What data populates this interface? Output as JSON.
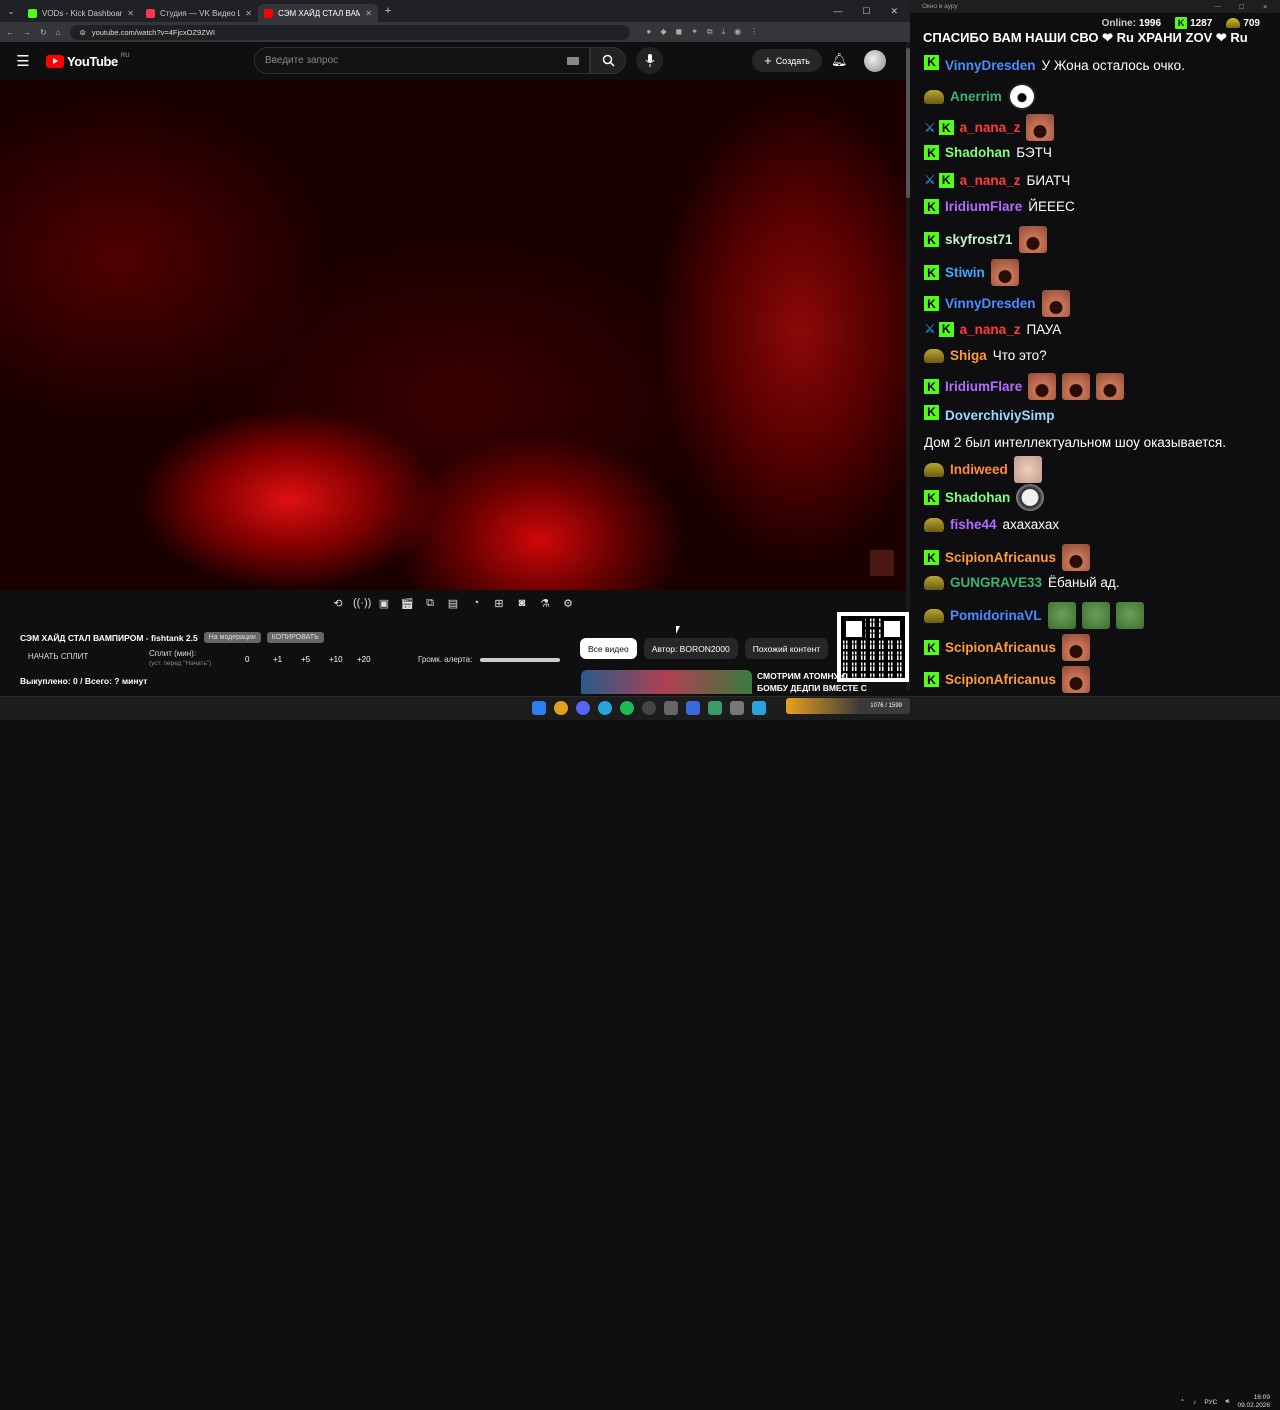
{
  "browser": {
    "tabs": [
      {
        "title": "VODs - Kick Dashboard",
        "favicon_color": "#53fc18"
      },
      {
        "title": "Студия — VK Видео Live",
        "favicon_color": "#ff3355"
      },
      {
        "title": "СЭМ ХАЙД СТАЛ ВАМПИ...",
        "favicon_color": "#ff0000",
        "active": true
      }
    ],
    "url": "youtube.com/watch?v=4FjcxOZ9ZWI",
    "window_controls": [
      "—",
      "☐",
      "✕"
    ]
  },
  "youtube": {
    "logo_text": "YouTube",
    "region": "RU",
    "search_placeholder": "Введите запрос",
    "create_label": "Создать"
  },
  "player_tools": [
    "loop",
    "audio",
    "screen-record",
    "clip",
    "pip",
    "subtitles",
    "speed",
    "add",
    "screenshot",
    "test",
    "settings"
  ],
  "panel": {
    "video_title": "СЭМ ХАЙД СТАЛ ВАМПИРОМ - fishtank 2.5",
    "pill_1": "На модерации",
    "pill_2": "КОПИРОВАТЬ",
    "start_split": "НАЧАТЬ СПЛИТ",
    "split_label": "Сплит (мин):",
    "split_sub": "(уст. перед \"Начать\")",
    "split_values": [
      "0",
      "+1",
      "+5",
      "+10",
      "+20"
    ],
    "alert_volume_label": "Громк. алерта:",
    "alert_volume_value": 1.0,
    "bought": "Выкуплено: 0 / Всего: ? минут"
  },
  "chips": [
    "Все видео",
    "Автор: BORON2000",
    "Похожий контент"
  ],
  "recommendation": {
    "title": "СМОТРИМ АТОМНУЮ БОМБУ ДЕДПИ ВМЕСТЕ С ..."
  },
  "chat": {
    "window_title": "Окно в ауру",
    "online_label": "Online:",
    "online": "1996",
    "kick_count": "1287",
    "other_count": "709",
    "first_line": "СПАСИБО ВАМ НАШИ СВО ❤ Ru ХРАНИ ZOV ❤ Ru",
    "messages": [
      {
        "user": "VinnyDresden",
        "color": "#4d8cff",
        "icon": "kick",
        "text": "У Жона осталось очко.",
        "emotes": []
      },
      {
        "user": "Anerrim",
        "color": "#3cb371",
        "icon": "sub",
        "text": "",
        "emotes": [
          "white"
        ]
      },
      {
        "user": "a_nana_z",
        "color": "#ff3b3b",
        "icon": "kick",
        "sword": true,
        "text": "",
        "emotes": [
          "emo"
        ]
      },
      {
        "user": "Shadohan",
        "color": "#7fff7f",
        "icon": "kick",
        "text": "БЭТЧ",
        "emotes": []
      },
      {
        "user": "a_nana_z",
        "color": "#ff3b3b",
        "icon": "kick",
        "sword": true,
        "text": "БИАТЧ",
        "emotes": []
      },
      {
        "user": "IridiumFlare",
        "color": "#b46bff",
        "icon": "kick",
        "text": "ЙЕЕЕС",
        "emotes": []
      },
      {
        "user": "skyfrost71",
        "color": "#c8f0c8",
        "icon": "kick",
        "text": "",
        "emotes": [
          "emo"
        ]
      },
      {
        "user": "Stiwin",
        "color": "#3fa9ff",
        "icon": "kick",
        "text": "",
        "emotes": [
          "emo"
        ]
      },
      {
        "user": "VinnyDresden",
        "color": "#4d8cff",
        "icon": "kick",
        "text": "",
        "emotes": [
          "emo"
        ]
      },
      {
        "user": "a_nana_z",
        "color": "#ff3b3b",
        "icon": "kick",
        "sword": true,
        "text": "ПАУА",
        "emotes": []
      },
      {
        "user": "Shiga",
        "color": "#ff9a3c",
        "icon": "sub",
        "text": "Что это?",
        "emotes": []
      },
      {
        "user": "IridiumFlare",
        "color": "#b46bff",
        "icon": "kick",
        "text": "",
        "emotes": [
          "emo",
          "emo",
          "emo"
        ]
      },
      {
        "user": "DoverchiviySimp",
        "color": "#9ad8ff",
        "icon": "kick",
        "text": "Дом 2 был интеллектуальном шоу оказывается.",
        "emotes": []
      },
      {
        "user": "Indiweed",
        "color": "#ff8a3c",
        "icon": "sub",
        "text": "",
        "emotes": [
          "pale"
        ]
      },
      {
        "user": "Shadohan",
        "color": "#7fff7f",
        "icon": "kick",
        "text": "",
        "emotes": [
          "face"
        ]
      },
      {
        "user": "fishe44",
        "color": "#b46bff",
        "icon": "sub",
        "text": "ахахахах",
        "emotes": []
      },
      {
        "user": "ScipionAfricanus",
        "color": "#ff9a3c",
        "icon": "kick",
        "text": "",
        "emotes": [
          "emo"
        ]
      },
      {
        "user": "GUNGRAVE33",
        "color": "#3cb371",
        "icon": "sub",
        "text": "Ёбаный ад.",
        "emotes": []
      },
      {
        "user": "PomidorinaVL",
        "color": "#4d8cff",
        "icon": "sub",
        "text": "",
        "emotes": [
          "pepe",
          "pepe",
          "pepe"
        ]
      },
      {
        "user": "ScipionAfricanus",
        "color": "#ff9a3c",
        "icon": "kick",
        "text": "",
        "emotes": [
          "emo"
        ]
      },
      {
        "user": "ScipionAfricanus",
        "color": "#ff9a3c",
        "icon": "kick",
        "text": "",
        "emotes": [
          "emo"
        ]
      }
    ]
  },
  "taskbar": {
    "badge_text": "1076 / 1599",
    "lang": "РУС",
    "time": "16:09",
    "date": "09.02.2026"
  }
}
